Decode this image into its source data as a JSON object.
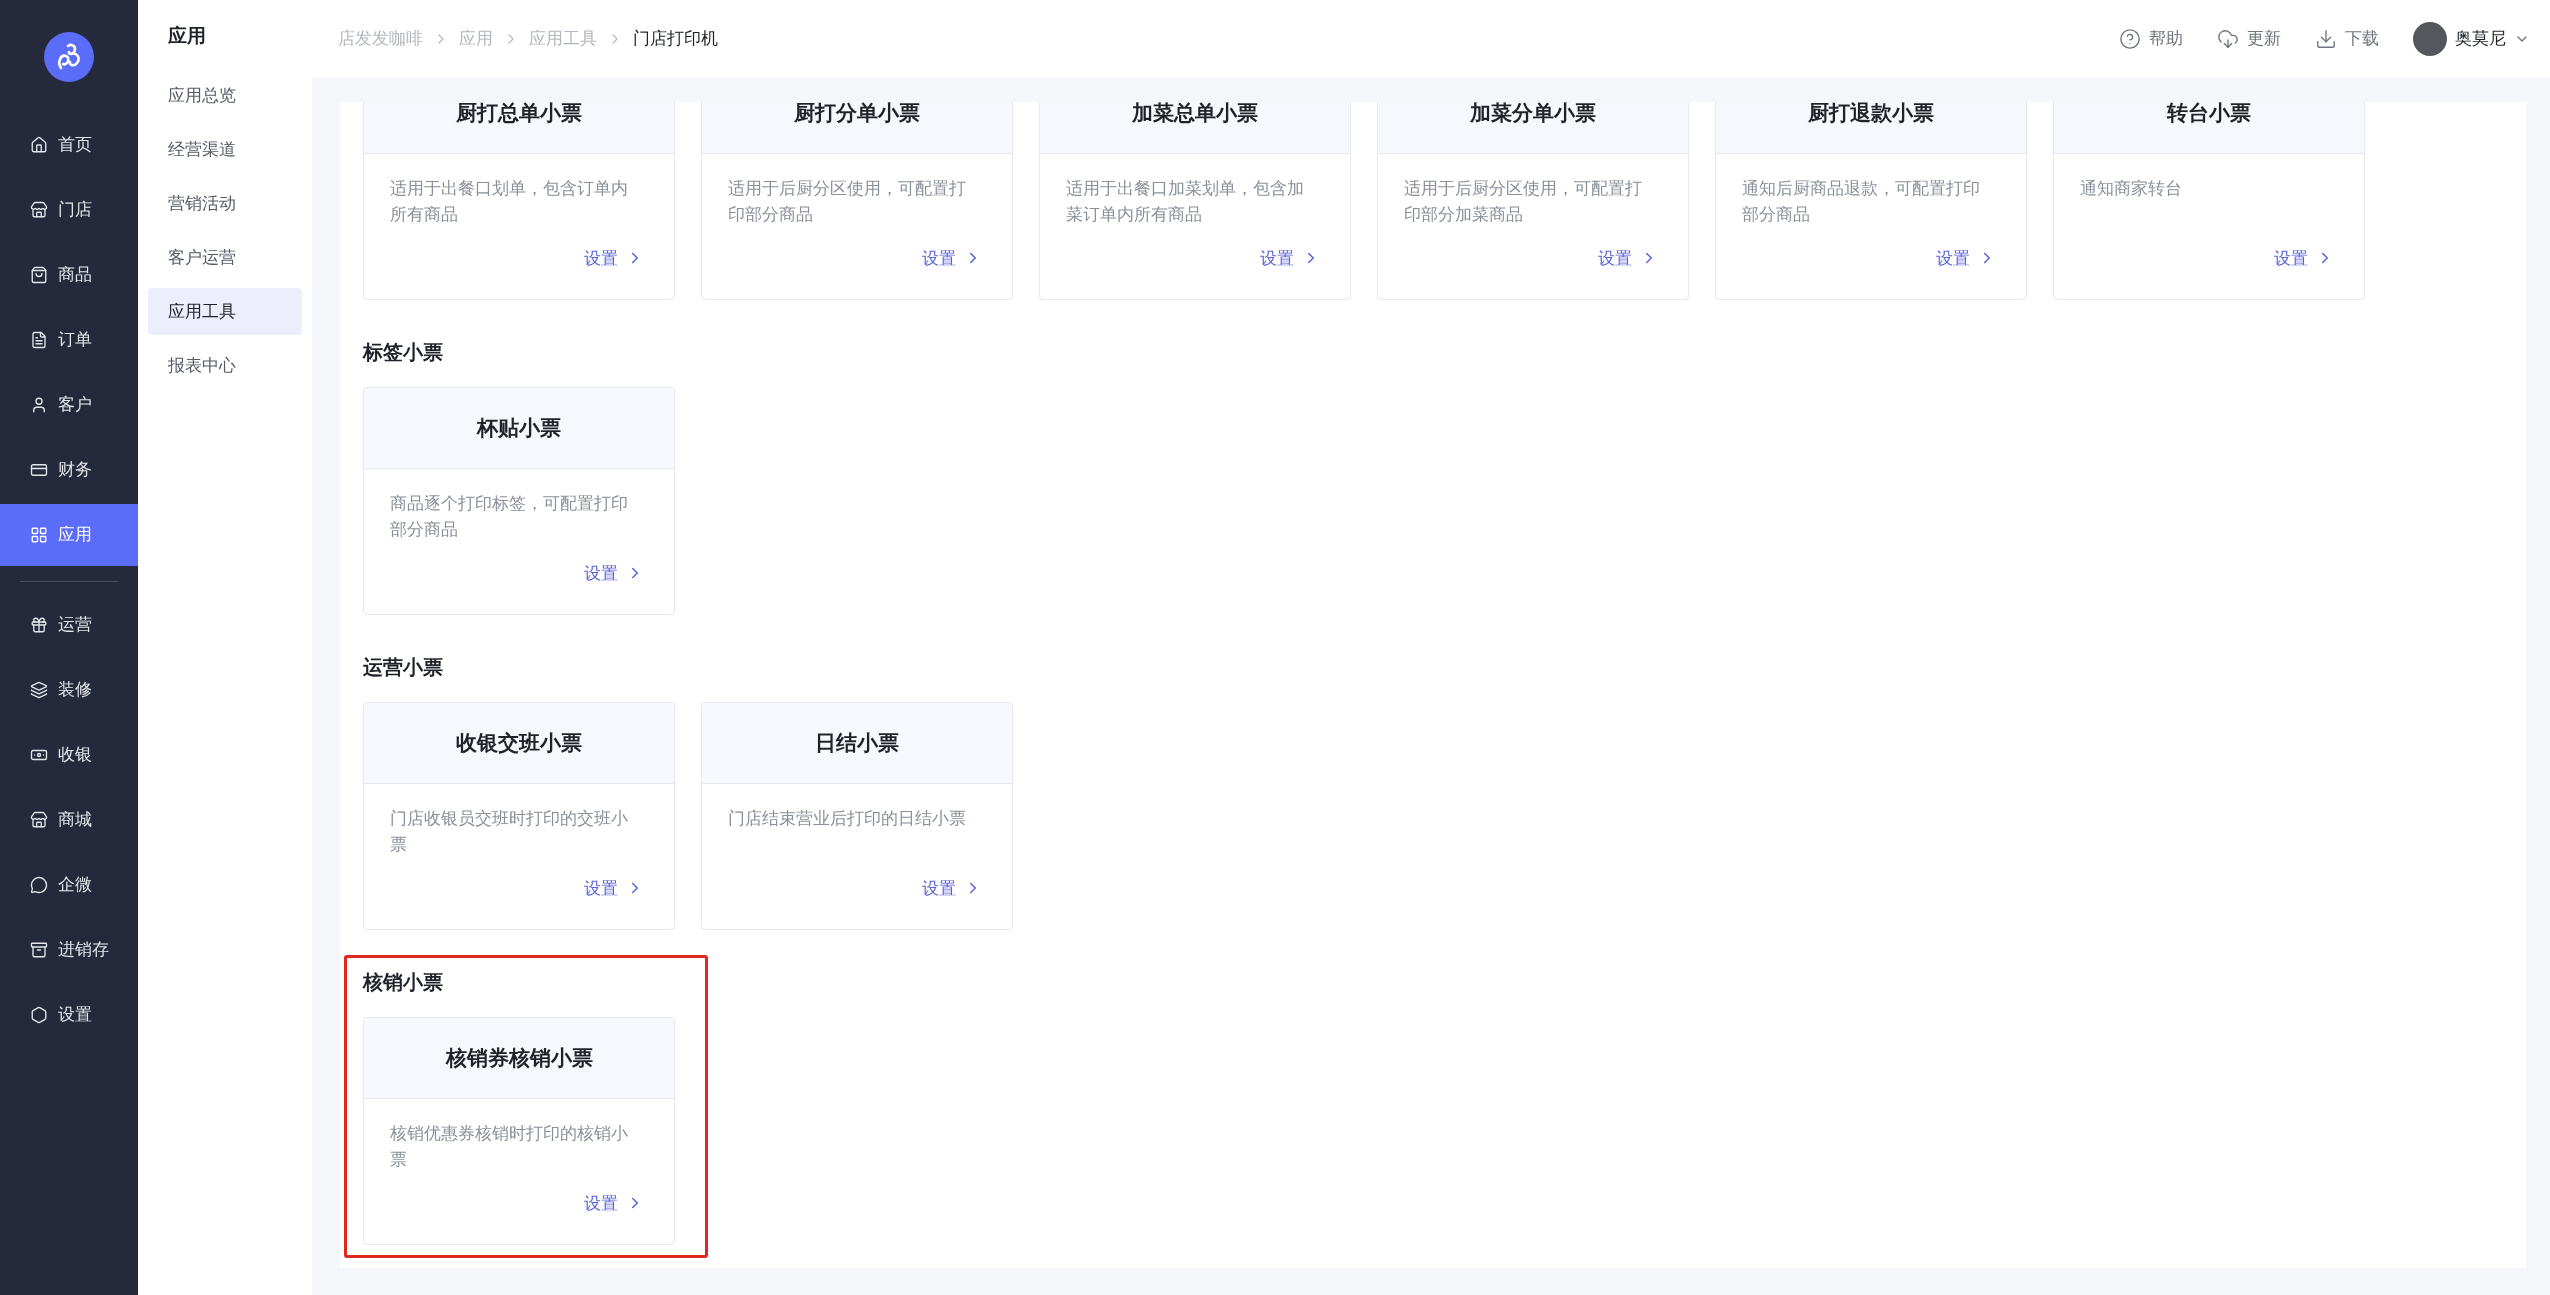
{
  "nav": {
    "groups": [
      [
        {
          "label": "首页",
          "selected": false
        },
        {
          "label": "门店",
          "selected": false
        },
        {
          "label": "商品",
          "selected": false
        },
        {
          "label": "订单",
          "selected": false
        },
        {
          "label": "客户",
          "selected": false
        },
        {
          "label": "财务",
          "selected": false
        },
        {
          "label": "应用",
          "selected": true
        }
      ],
      [
        {
          "label": "运营",
          "selected": false
        },
        {
          "label": "装修",
          "selected": false
        },
        {
          "label": "收银",
          "selected": false
        },
        {
          "label": "商城",
          "selected": false
        },
        {
          "label": "企微",
          "selected": false
        },
        {
          "label": "进销存",
          "selected": false
        },
        {
          "label": "设置",
          "selected": false
        }
      ]
    ]
  },
  "subnav": {
    "title": "应用",
    "items": [
      {
        "label": "应用总览",
        "selected": false
      },
      {
        "label": "经营渠道",
        "selected": false
      },
      {
        "label": "营销活动",
        "selected": false
      },
      {
        "label": "客户运营",
        "selected": false
      },
      {
        "label": "应用工具",
        "selected": true
      },
      {
        "label": "报表中心",
        "selected": false
      }
    ]
  },
  "breadcrumb": [
    {
      "label": "店发发咖啡",
      "current": false
    },
    {
      "label": "应用",
      "current": false
    },
    {
      "label": "应用工具",
      "current": false
    },
    {
      "label": "门店打印机",
      "current": true
    }
  ],
  "header_actions": [
    {
      "label": "帮助"
    },
    {
      "label": "更新"
    },
    {
      "label": "下载"
    }
  ],
  "user": {
    "name": "奥莫尼"
  },
  "sections": [
    {
      "highlighted": false,
      "cards": [
        {
          "title": "厨打总单小票",
          "description": "适用于出餐口划单，包含订单内所有商品",
          "action": "设置"
        },
        {
          "title": "厨打分单小票",
          "description": "适用于后厨分区使用，可配置打印部分商品",
          "action": "设置"
        },
        {
          "title": "加菜总单小票",
          "description": "适用于出餐口加菜划单，包含加菜订单内所有商品",
          "action": "设置"
        },
        {
          "title": "加菜分单小票",
          "description": "适用于后厨分区使用，可配置打印部分加菜商品",
          "action": "设置"
        },
        {
          "title": "厨打退款小票",
          "description": "通知后厨商品退款，可配置打印部分商品",
          "action": "设置"
        },
        {
          "title": "转台小票",
          "description": "通知商家转台",
          "action": "设置"
        }
      ]
    },
    {
      "title": "标签小票",
      "highlighted": false,
      "cards": [
        {
          "title": "杯贴小票",
          "description": "商品逐个打印标签，可配置打印部分商品",
          "action": "设置"
        }
      ]
    },
    {
      "title": "运营小票",
      "highlighted": false,
      "cards": [
        {
          "title": "收银交班小票",
          "description": "门店收银员交班时打印的交班小票",
          "action": "设置"
        },
        {
          "title": "日结小票",
          "description": "门店结束营业后打印的日结小票",
          "action": "设置"
        }
      ]
    },
    {
      "title": "核销小票",
      "highlighted": true,
      "cards": [
        {
          "title": "核销券核销小票",
          "description": "核销优惠券核销时打印的核销小票",
          "action": "设置"
        }
      ]
    }
  ]
}
